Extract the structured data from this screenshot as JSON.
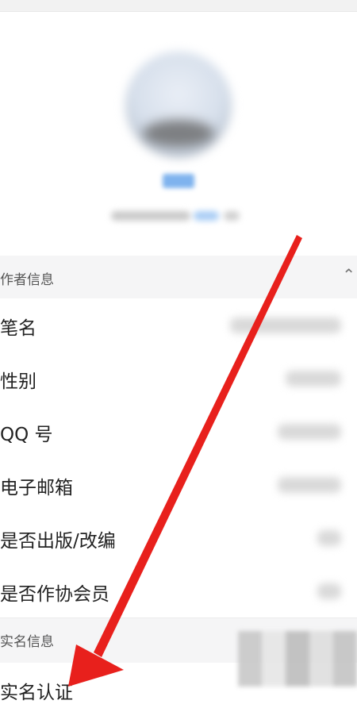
{
  "profile": {
    "avatar_icon": "user-avatar"
  },
  "sections": {
    "author_info": {
      "title": "作者信息",
      "collapse_icon": "chevron-up-icon",
      "rows": [
        {
          "label": "笔名"
        },
        {
          "label": "性别"
        },
        {
          "label": "QQ 号"
        },
        {
          "label": "电子邮箱"
        },
        {
          "label": "是否出版/改编"
        },
        {
          "label": "是否作协会员"
        }
      ]
    },
    "real_name_info": {
      "title": "实名信息",
      "rows": [
        {
          "label": "实名认证"
        }
      ]
    }
  },
  "annotation": {
    "arrow_color": "#e8201c"
  }
}
